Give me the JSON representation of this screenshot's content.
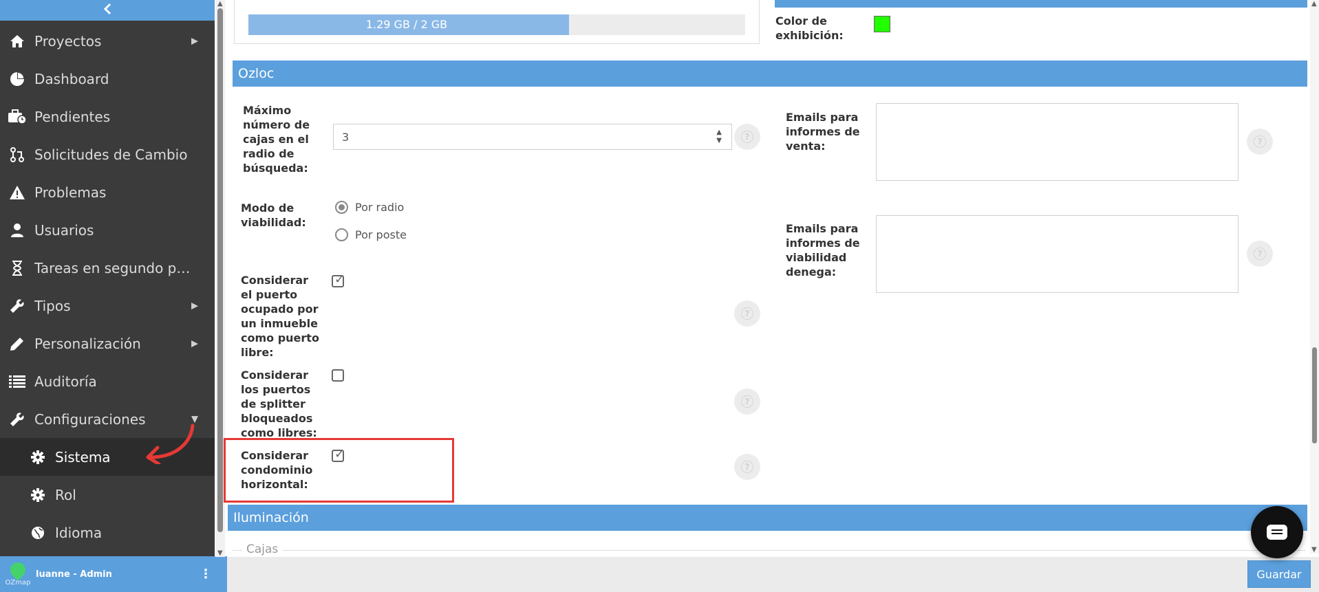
{
  "sidebar": {
    "items": [
      {
        "label": "Proyectos",
        "icon": "home-icon",
        "has_caret": true
      },
      {
        "label": "Dashboard",
        "icon": "pie-chart-icon",
        "has_caret": false
      },
      {
        "label": "Pendientes",
        "icon": "briefcase-clock-icon",
        "has_caret": false
      },
      {
        "label": "Solicitudes de Cambio",
        "icon": "git-pull-request-icon",
        "has_caret": false
      },
      {
        "label": "Problemas",
        "icon": "warning-icon",
        "has_caret": false
      },
      {
        "label": "Usuarios",
        "icon": "user-icon",
        "has_caret": false
      },
      {
        "label": "Tareas en segundo pla...",
        "icon": "hourglass-icon",
        "has_caret": false
      },
      {
        "label": "Tipos",
        "icon": "wrench-icon",
        "has_caret": true
      },
      {
        "label": "Personalización",
        "icon": "pencil-icon",
        "has_caret": true
      },
      {
        "label": "Auditoría",
        "icon": "list-icon",
        "has_caret": false
      },
      {
        "label": "Configuraciones",
        "icon": "wrench-icon",
        "has_caret": true,
        "expanded": true
      }
    ],
    "subitems": [
      {
        "label": "Sistema",
        "icon": "gear-icon",
        "active": true
      },
      {
        "label": "Rol",
        "icon": "gear-icon",
        "active": false
      },
      {
        "label": "Idioma",
        "icon": "globe-icon",
        "active": false
      }
    ],
    "user": {
      "name": "luanne - Admin",
      "logo_text": "OZmap"
    }
  },
  "storage": {
    "text": "1.29 GB / 2 GB",
    "used_fraction": 0.645
  },
  "display_color": {
    "label": "Color de exhibición:",
    "value": "#22ff00"
  },
  "ozloc": {
    "title": "Ozloc",
    "max_boxes_label": "Máximo número de cajas en el radio de búsqueda:",
    "max_boxes_value": "3",
    "viability_label": "Modo de viabilidad:",
    "viability_options": [
      "Por radio",
      "Por poste"
    ],
    "viability_selected": "Por radio",
    "occupied_port_label": "Considerar el puerto ocupado por un inmueble como puerto libre:",
    "occupied_port_checked": true,
    "blocked_ports_label": "Considerar los puertos de splitter bloqueados como libres:",
    "blocked_ports_checked": false,
    "horizontal_condo_label": "Considerar condominio horizontal:",
    "horizontal_condo_checked": true,
    "sales_emails_label": "Emails para informes de venta:",
    "denied_emails_label": "Emails para informes de viabilidad denega:"
  },
  "iluminacion": {
    "title": "Iluminación"
  },
  "cajas": {
    "title": "Cajas"
  },
  "footer": {
    "save_label": "Guardar"
  }
}
